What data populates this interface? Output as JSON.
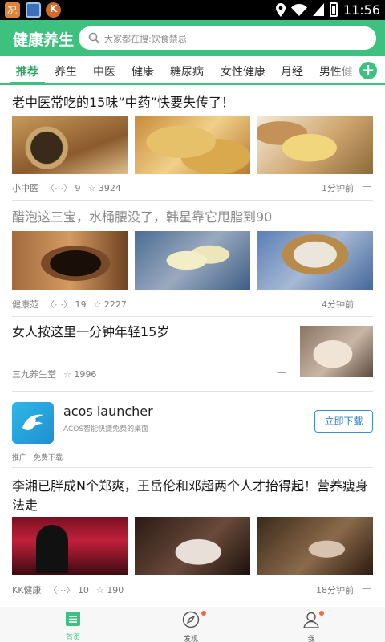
{
  "status_bar": {
    "time": "11:56"
  },
  "header": {
    "title": "健康养生",
    "search_placeholder": "大家都在搜:饮食禁忌",
    "accent_color": "#3ec07f"
  },
  "tabs": [
    "推荐",
    "养生",
    "中医",
    "健康",
    "糖尿病",
    "女性健康",
    "月经",
    "男性健"
  ],
  "feed": [
    {
      "title": "老中医常吃的15味“中药”快要失传了！",
      "source": "小中医",
      "comments": "9",
      "likes": "3924",
      "time": "1分钟前",
      "images": [
        "ginger-tea",
        "ginger",
        "ginger"
      ]
    },
    {
      "title": "醋泡这三宝，水桶腰没了，韩星靠它甩脂到90",
      "source": "健康范",
      "comments": "19",
      "likes": "2227",
      "time": "4分钟前",
      "images": [
        "barrel",
        "apples",
        "jar"
      ]
    },
    {
      "title": "女人按这里一分钟年轻15岁",
      "source": "三九养生堂",
      "likes": "1996",
      "images": [
        "hand"
      ]
    },
    {
      "title": "李湘已胖成N个郑爽，王岳伦和邓超两个人才抬得起！营养瘦身法走",
      "source": "KK健康",
      "comments": "10",
      "likes": "190",
      "time": "18分钟前",
      "images": [
        "party",
        "party",
        "party"
      ]
    }
  ],
  "ad": {
    "name": "acos launcher",
    "description": "ACOS智能快捷免费的桌面",
    "button": "立即下载",
    "tag": "推广",
    "sub": "免费下载"
  },
  "bottom_nav": [
    {
      "label": "首页",
      "icon": "home-icon"
    },
    {
      "label": "发现",
      "icon": "compass-icon"
    },
    {
      "label": "我",
      "icon": "user-icon"
    }
  ],
  "dismiss_glyph": "—"
}
